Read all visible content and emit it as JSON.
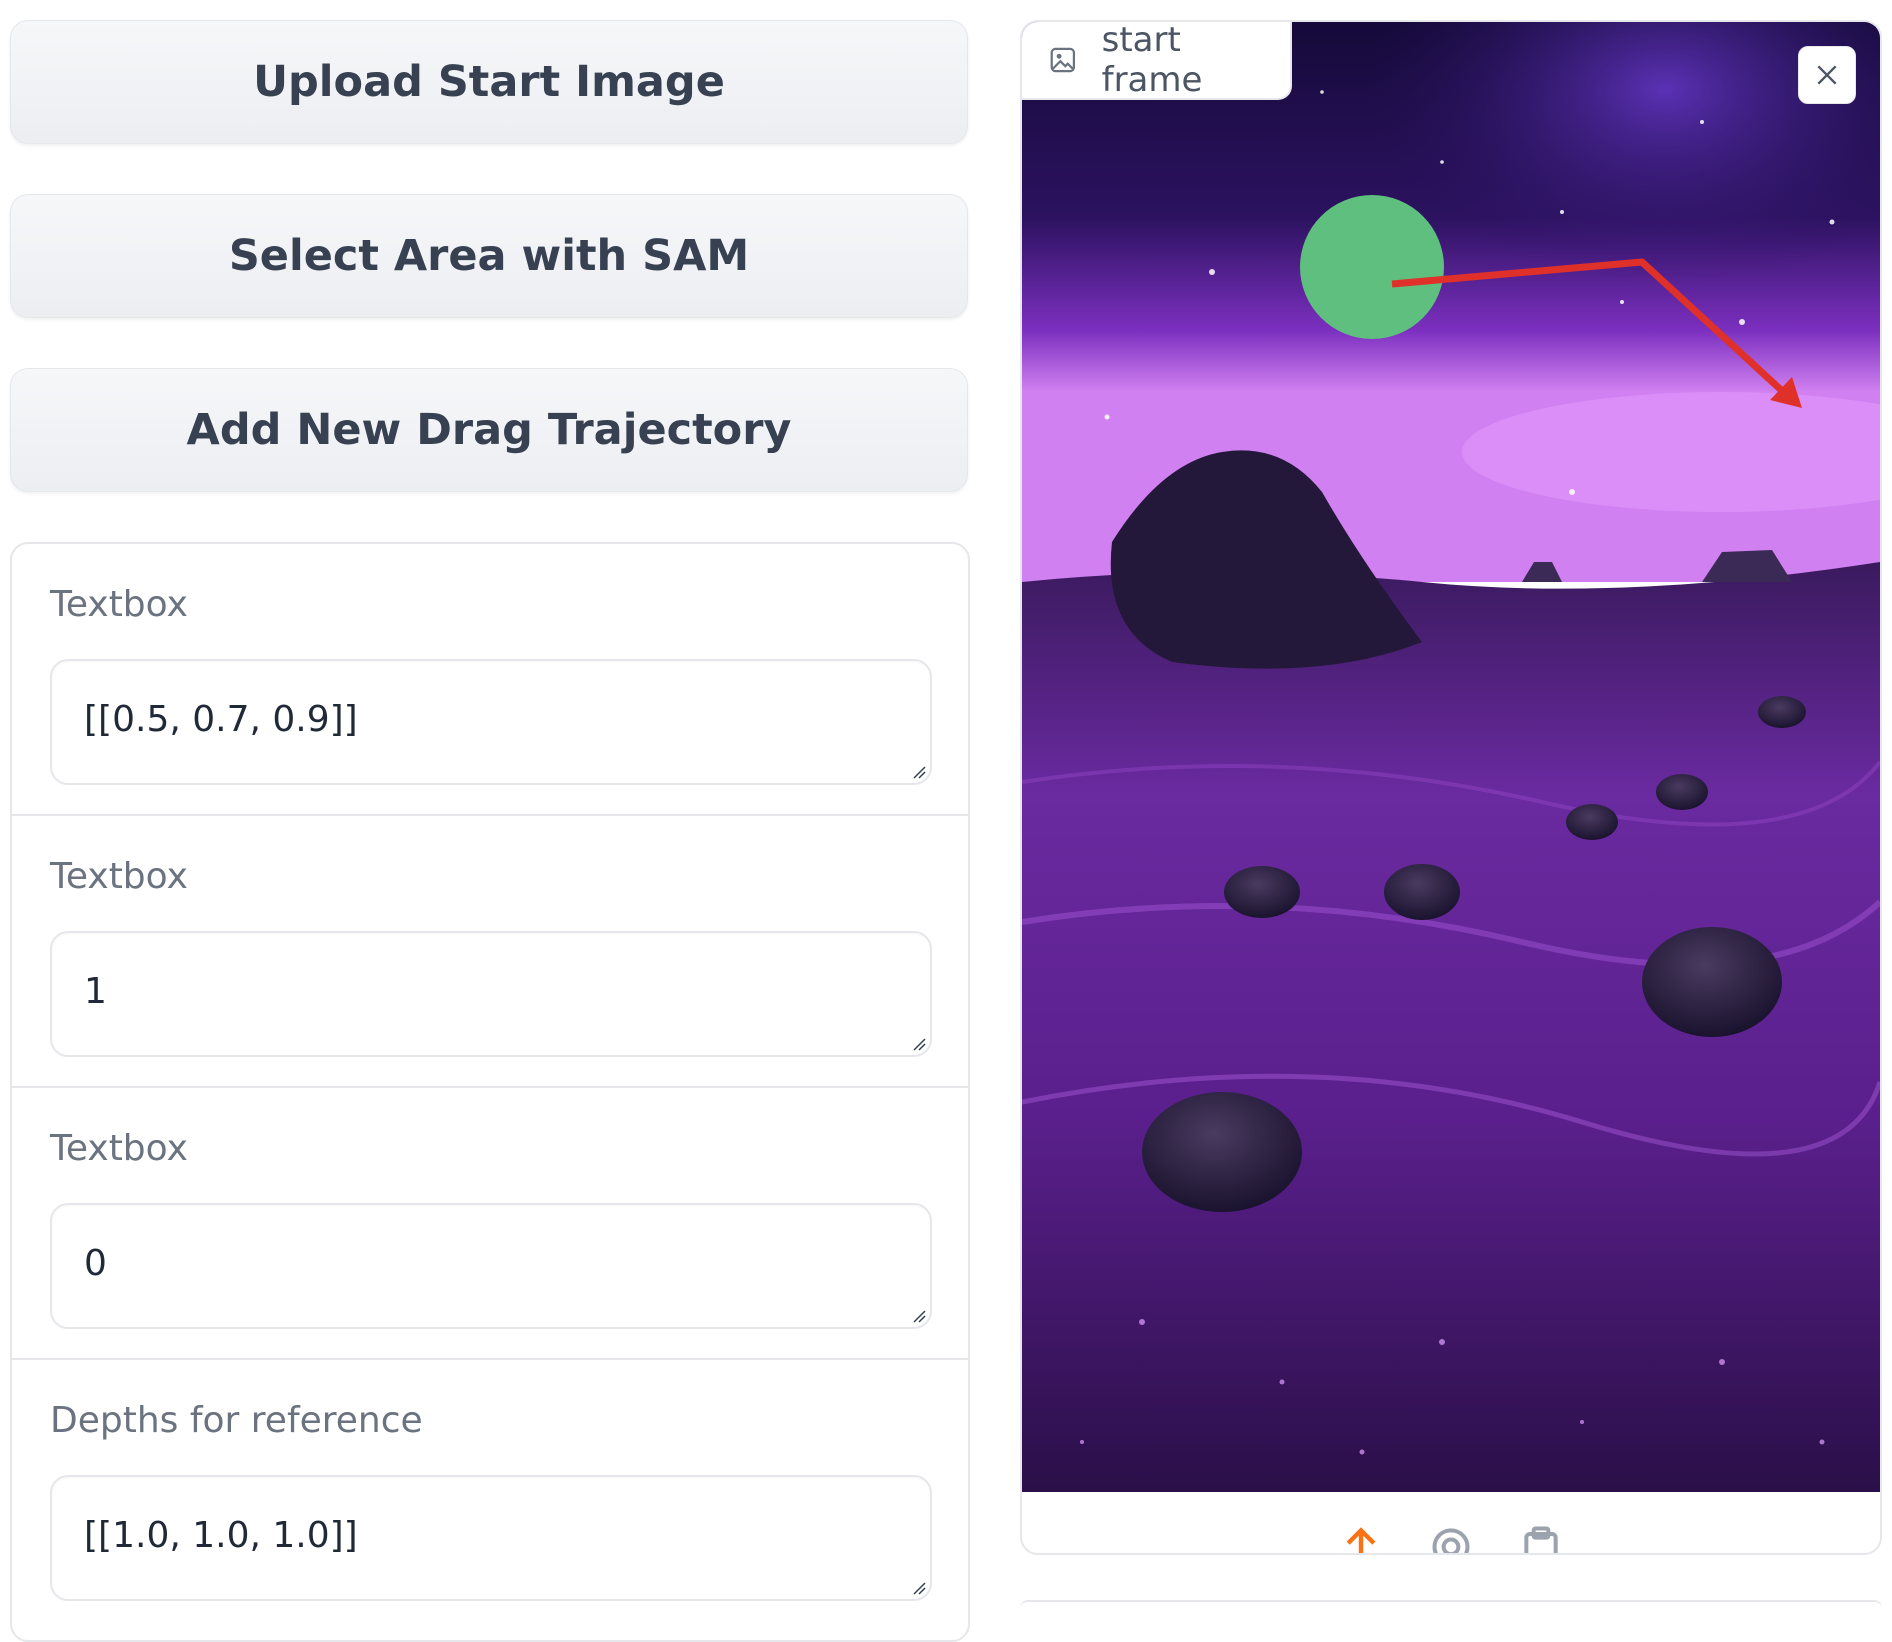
{
  "buttons": {
    "upload": "Upload Start Image",
    "select_sam": "Select Area with SAM",
    "add_trajectory": "Add New Drag Trajectory"
  },
  "fields": [
    {
      "label": "Textbox",
      "value": "[[0.5, 0.7, 0.9]]"
    },
    {
      "label": "Textbox",
      "value": "1"
    },
    {
      "label": "Textbox",
      "value": "0"
    },
    {
      "label": "Depths for reference",
      "value": "[[1.0, 1.0, 1.0]]"
    }
  ],
  "image_panel": {
    "label": "start frame",
    "icons": {
      "label": "image-icon",
      "close": "close-icon"
    },
    "toolbar": [
      "upload-icon",
      "webcam-icon",
      "clipboard-icon"
    ],
    "colors": {
      "trajectory": "#e0302a",
      "mask": "#5fbf7f",
      "upload_accent": "#f97316"
    }
  }
}
